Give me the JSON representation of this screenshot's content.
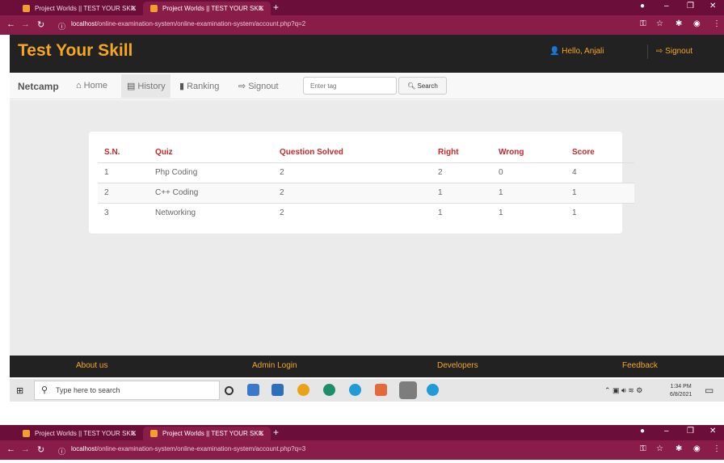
{
  "browser": {
    "tabs": [
      {
        "title": "Project Worlds || TEST YOUR SKIL",
        "active": false
      },
      {
        "title": "Project Worlds || TEST YOUR SKIL",
        "active": true
      }
    ],
    "new_tab": "+",
    "url_host": "localhost",
    "url_path_1": "/online-examination-system/online-examination-system/account.php?q=2",
    "url_path_2": "/online-examination-system/online-examination-system/account.php?q=3"
  },
  "header": {
    "logo": "Test Your Skill",
    "greeting": "Hello,",
    "user": "Anjali",
    "signout": "Signout"
  },
  "navbar": {
    "brand": "Netcamp",
    "items": [
      {
        "label": "Home",
        "icon": "home-icon"
      },
      {
        "label": "History",
        "icon": "history-icon"
      },
      {
        "label": "Ranking",
        "icon": "bar-chart-icon"
      },
      {
        "label": "Signout",
        "icon": "signout-icon"
      }
    ],
    "tag_placeholder": "Enter tag",
    "search_label": "Search"
  },
  "history_table": {
    "headers": [
      "S.N.",
      "Quiz",
      "Question Solved",
      "Right",
      "Wrong",
      "Score"
    ],
    "rows": [
      [
        "1",
        "Php Coding",
        "2",
        "2",
        "0",
        "4"
      ],
      [
        "2",
        "C++ Coding",
        "2",
        "1",
        "1",
        "1"
      ],
      [
        "3",
        "Networking",
        "2",
        "1",
        "1",
        "1"
      ]
    ]
  },
  "footer": {
    "links": [
      "About us",
      "Admin Login",
      "Developers",
      "Feedback"
    ]
  },
  "taskbar": {
    "search_placeholder": "Type here to search",
    "time": "1:34 PM",
    "date": "6/8/2021"
  },
  "colors": {
    "accent": "#f5a623",
    "table_header": "#c62828",
    "browser_frame": "#8a1c4a"
  }
}
